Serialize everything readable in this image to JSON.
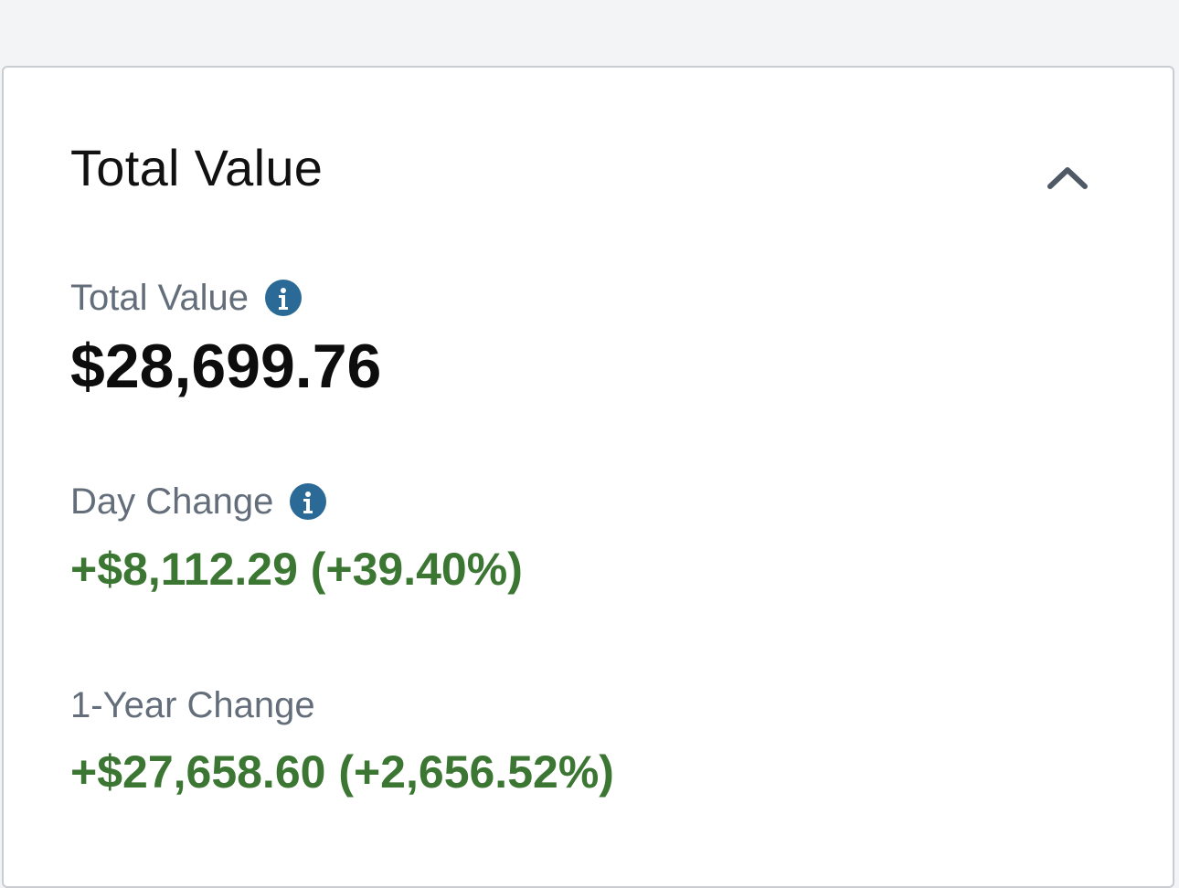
{
  "card": {
    "title": "Total Value",
    "collapse_icon": "chevron-up-icon"
  },
  "total_value": {
    "label": "Total Value",
    "info_icon": "info-icon",
    "value": "$28,699.76"
  },
  "day_change": {
    "label": "Day Change",
    "info_icon": "info-icon",
    "value": "+$8,112.29 (+39.40%)"
  },
  "year_change": {
    "label": "1-Year Change",
    "value": "+$27,658.60 (+2,656.52%)"
  },
  "colors": {
    "positive": "#3b7632",
    "info": "#2b6a96",
    "label": "#646e7a"
  }
}
